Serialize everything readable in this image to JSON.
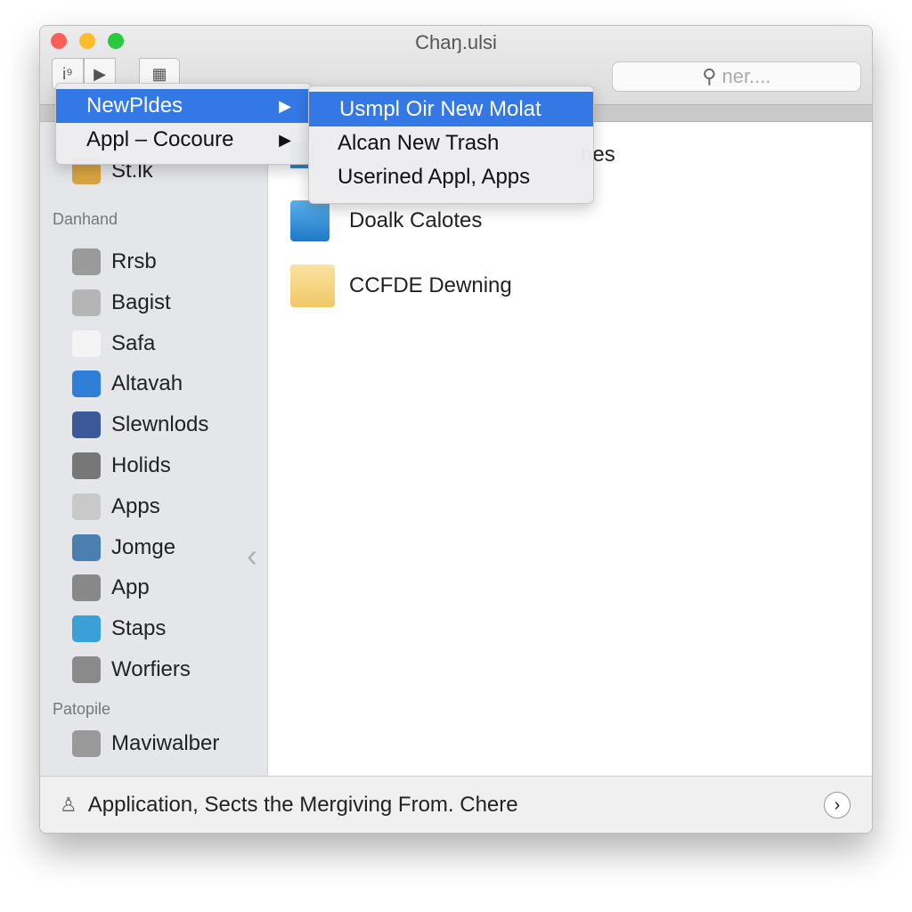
{
  "window": {
    "title": "Chaŋ.ulsi"
  },
  "toolbar": {
    "search_placeholder": "ner...."
  },
  "sidebar": {
    "top_item": "St.lk",
    "section1": "Danhand",
    "items": [
      {
        "label": "Rrsb",
        "icon": "drive-icon",
        "color": "#9a9a9a"
      },
      {
        "label": "Bagist",
        "icon": "disk-icon",
        "color": "#b5b5b5"
      },
      {
        "label": "Safa",
        "icon": "document-icon",
        "color": "#f4f4f4"
      },
      {
        "label": "Altavah",
        "icon": "app-store-icon",
        "color": "#2f7fd8"
      },
      {
        "label": "Slewnlods",
        "icon": "facebook-icon",
        "color": "#3b5998"
      },
      {
        "label": "Holids",
        "icon": "keyboard-icon",
        "color": "#777"
      },
      {
        "label": "Apps",
        "icon": "compass-icon",
        "color": "#c9c9c9"
      },
      {
        "label": "Jomge",
        "icon": "phone-icon",
        "color": "#4a7fb0"
      },
      {
        "label": "App",
        "icon": "camera-icon",
        "color": "#888"
      },
      {
        "label": "Staps",
        "icon": "safari-icon",
        "color": "#3aa0d8"
      },
      {
        "label": "Worfiers",
        "icon": "globe-icon",
        "color": "#8a8a8a"
      }
    ],
    "section2": "Patopile",
    "items2": [
      {
        "label": "Maviwalber",
        "icon": "briefcase-icon",
        "color": "#999"
      }
    ]
  },
  "content": {
    "items": [
      {
        "label": "nes",
        "icon": "app-icon"
      },
      {
        "label": "Doalk Calotes",
        "icon": "document-app-icon"
      },
      {
        "label": "CCFDE Dewning",
        "icon": "folder-icon"
      }
    ]
  },
  "menu": {
    "items": [
      {
        "label": "NewPldes"
      },
      {
        "label": "Appl – Cocoure"
      }
    ]
  },
  "submenu": {
    "items": [
      {
        "label": "Usmpl Oir New Molat"
      },
      {
        "label": "Alcan New Trash"
      },
      {
        "label": "Userined Appl, Apps"
      }
    ]
  },
  "status": {
    "text": "Application, Sects the Mergiving From. Chere"
  },
  "colors": {
    "accent": "#3478e6",
    "close": "#fc5f57",
    "minimize": "#fdbc2e",
    "zoom": "#29c940"
  }
}
